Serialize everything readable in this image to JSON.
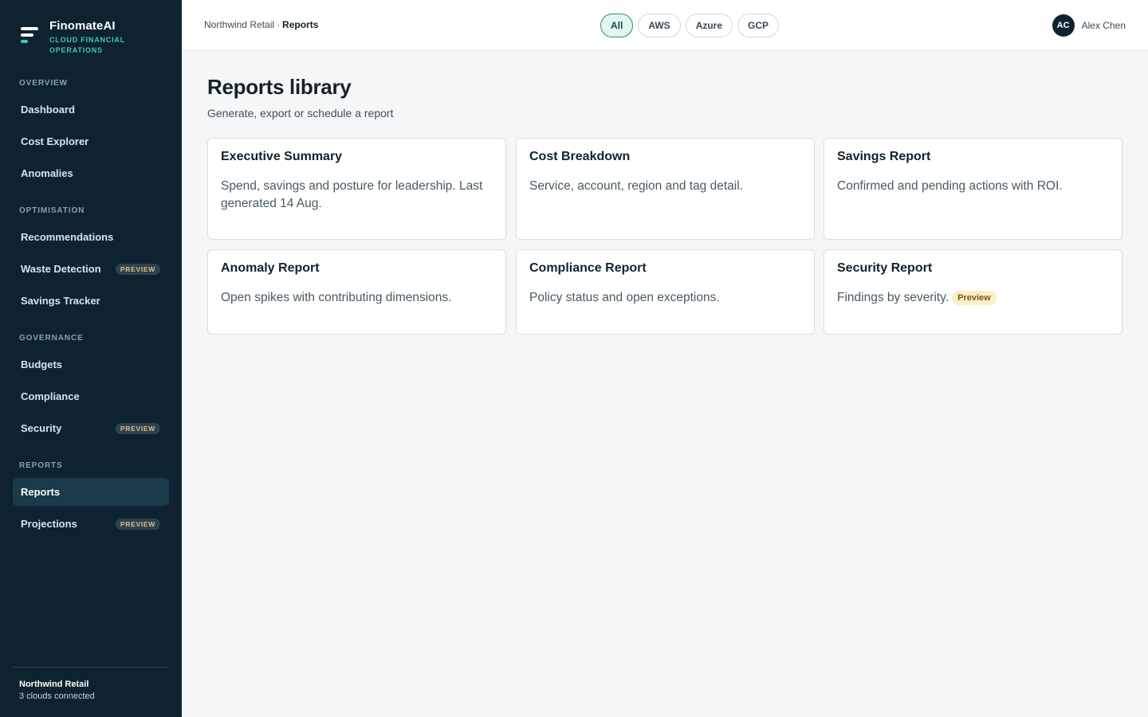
{
  "brand": {
    "name": "FinomateAI",
    "tagline": "CLOUD FINANCIAL OPERATIONS"
  },
  "sidebar": {
    "sections": [
      {
        "title": "OVERVIEW"
      },
      {
        "title": "OPTIMISATION"
      },
      {
        "title": "GOVERNANCE"
      },
      {
        "title": "REPORTS"
      }
    ],
    "items": [
      {
        "label": "Dashboard"
      },
      {
        "label": "Cost Explorer"
      },
      {
        "label": "Anomalies"
      },
      {
        "label": "Recommendations"
      },
      {
        "label": "Waste Detection",
        "badge": "PREVIEW"
      },
      {
        "label": "Savings Tracker"
      },
      {
        "label": "Budgets"
      },
      {
        "label": "Compliance"
      },
      {
        "label": "Security",
        "badge": "PREVIEW"
      },
      {
        "label": "Reports",
        "active": true
      },
      {
        "label": "Projections",
        "badge": "PREVIEW"
      }
    ],
    "footer": {
      "org": "Northwind Retail",
      "status": "3 clouds connected"
    }
  },
  "header": {
    "breadcrumb": {
      "org": "Northwind Retail",
      "separator": "·",
      "current": "Reports"
    },
    "filters": [
      {
        "label": "All",
        "active": true
      },
      {
        "label": "AWS"
      },
      {
        "label": "Azure"
      },
      {
        "label": "GCP"
      }
    ],
    "user": {
      "initials": "AC",
      "name": "Alex Chen"
    }
  },
  "main": {
    "title": "Reports library",
    "subtitle": "Generate, export or schedule a report",
    "reports": [
      {
        "title": "Executive Summary",
        "description": "Spend, savings and posture for leadership. Last generated 14 Aug."
      },
      {
        "title": "Cost Breakdown",
        "description": "Service, account, region and tag detail."
      },
      {
        "title": "Savings Report",
        "description": "Confirmed and pending actions with ROI."
      },
      {
        "title": "Anomaly Report",
        "description": "Open spikes with contributing dimensions."
      },
      {
        "title": "Compliance Report",
        "description": "Policy status and open exceptions."
      },
      {
        "title": "Security Report",
        "description": "Findings by severity.",
        "badge": "Preview"
      }
    ]
  },
  "colors": {
    "sidebar_bg": "#0e2230",
    "accent": "#3fc8b4",
    "active_nav_bg": "#1b3a4a",
    "preview_badge": "#fbefc7"
  }
}
